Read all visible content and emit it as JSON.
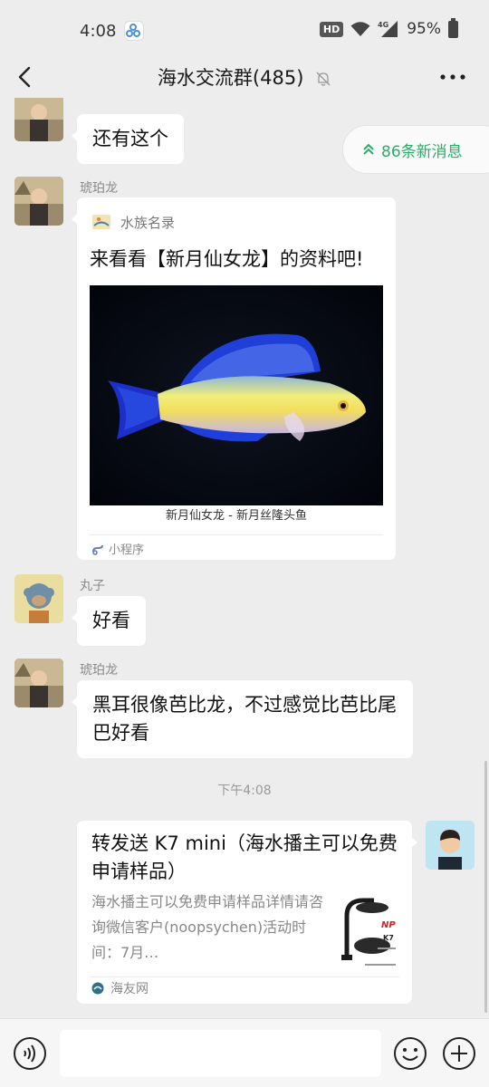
{
  "status_bar": {
    "time": "4:08",
    "hd": "HD",
    "battery": "95%",
    "icons": [
      "app-icon",
      "wifi-icon",
      "signal-4g-icon",
      "battery-icon"
    ]
  },
  "header": {
    "title": "海水交流群(485)",
    "icons": [
      "back-icon",
      "mute-bell-icon",
      "more-icon"
    ]
  },
  "new_messages": {
    "label": "86条新消息",
    "color": "#2aae67"
  },
  "messages": [
    {
      "type": "text",
      "side": "left",
      "text": "还有这个"
    },
    {
      "type": "mini_program",
      "side": "left",
      "sender": "琥珀龙",
      "app_name": "水族名录",
      "title": "来看看【新月仙女龙】的资料吧!",
      "caption": "新月仙女龙 - 新月丝隆头鱼",
      "footer": "小程序"
    },
    {
      "type": "text",
      "side": "left",
      "sender": "丸子",
      "text": "好看"
    },
    {
      "type": "text",
      "side": "left",
      "sender": "琥珀龙",
      "text": "黑耳很像芭比龙，不过感觉比芭比尾巴好看"
    },
    {
      "type": "timestamp",
      "text": "下午4:08"
    },
    {
      "type": "link",
      "side": "right",
      "title": "转发送 K7 mini（海水播主可以免费申请样品）",
      "description": "海水播主可以免费申请样品详情请咨询微信客户(noopsychen)活动时间：7月…",
      "source": "海友网"
    }
  ],
  "input_bar": {
    "icons": [
      "voice-icon",
      "emoji-icon",
      "plus-icon"
    ]
  }
}
